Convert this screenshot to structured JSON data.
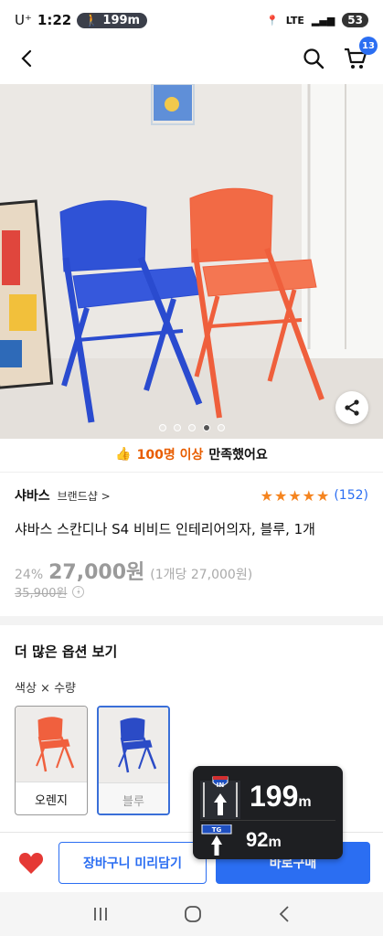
{
  "status": {
    "carrier": "U⁺",
    "time": "1:22",
    "nav_pill_distance": "199m",
    "network": "LTE",
    "battery": "53"
  },
  "header": {
    "cart_count": "13"
  },
  "gallery": {
    "dot_count": 5,
    "active_dot": 4
  },
  "satisfaction": {
    "highlight": "100명 이상",
    "suffix": "만족했어요"
  },
  "brand": {
    "name": "샤바스",
    "shop_link": "브랜드샵 >",
    "rating_stars": 5,
    "rating_count": "(152)"
  },
  "product": {
    "title": "샤바스 스칸디나 S4 비비드 인테리어의자, 블루, 1개",
    "discount": "24%",
    "price": "27,000원",
    "unit_price": "(1개당 27,000원)",
    "original_price": "35,900원"
  },
  "options": {
    "title": "더 많은 옵션 보기",
    "subtitle": "색상 × 수량",
    "items": [
      {
        "label": "오렌지",
        "selected": false,
        "color": "#f0603e"
      },
      {
        "label": "블루",
        "selected": true,
        "color": "#2b4bc6"
      }
    ]
  },
  "bottom_bar": {
    "preview_label": "장바구니 미리담기",
    "buy_label": "바로구매"
  },
  "nav_overlay": {
    "sign1": "IN",
    "distance1": "199",
    "unit1": "m",
    "sign2": "TG",
    "distance2": "92",
    "unit2": "m"
  },
  "colors": {
    "accent": "#2b6ef2",
    "star": "#f5841f",
    "highlight": "#e85d00",
    "heart": "#e53935"
  }
}
